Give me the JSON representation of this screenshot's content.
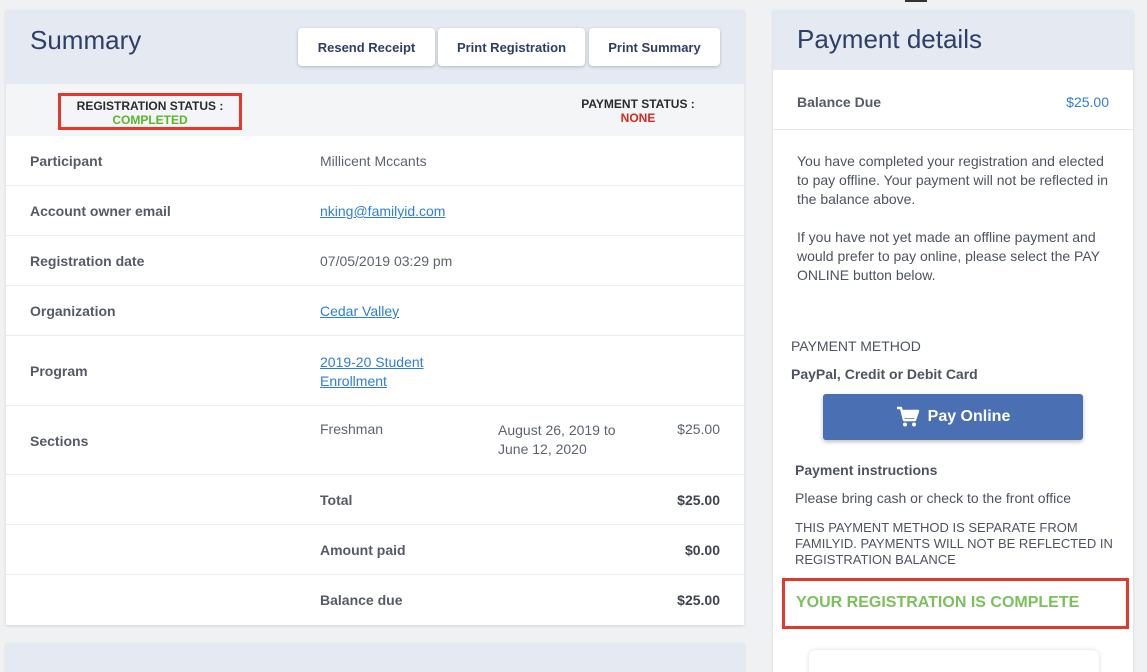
{
  "summary": {
    "title": "Summary",
    "buttons": {
      "resend_receipt": "Resend Receipt",
      "print_registration": "Print Registration",
      "print_summary": "Print Summary"
    },
    "registration_status_label": "REGISTRATION STATUS :",
    "registration_status_value": "COMPLETED",
    "payment_status_label": "PAYMENT STATUS :",
    "payment_status_value": "NONE",
    "rows": {
      "participant": {
        "label": "Participant",
        "value": "Millicent Mccants"
      },
      "email": {
        "label": "Account owner email",
        "value": "nking@familyid.com"
      },
      "reg_date": {
        "label": "Registration date",
        "value": "07/05/2019 03:29 pm"
      },
      "organization": {
        "label": "Organization",
        "value": "Cedar Valley"
      },
      "program": {
        "label": "Program",
        "value_line1": "2019-20 Student",
        "value_line2": "Enrollment"
      },
      "sections": {
        "label": "Sections",
        "name": "Freshman",
        "dates_line1": "August 26, 2019 to",
        "dates_line2": "June 12, 2020",
        "amount": "$25.00"
      }
    },
    "totals": {
      "total": {
        "label": "Total",
        "value": "$25.00"
      },
      "amount_paid": {
        "label": "Amount paid",
        "value": "$0.00"
      },
      "balance_due": {
        "label": "Balance due",
        "value": "$25.00"
      }
    }
  },
  "payment": {
    "title": "Payment details",
    "balance_label": "Balance Due",
    "balance_value": "$25.00",
    "info_1": "You have completed your registration and elected to pay offline. Your payment will not be reflected in the balance above.",
    "info_2": "If you have not yet made an offline payment and would prefer to pay online, please select the PAY ONLINE button below.",
    "method_label": "PAYMENT METHOD",
    "method_type": "PayPal, Credit or Debit Card",
    "pay_online": "Pay Online",
    "instructions_label": "Payment instructions",
    "instructions_text": "Please bring cash or check to the front office",
    "instructions_note": "THIS PAYMENT METHOD IS SEPARATE FROM FAMILYID. PAYMENTS WILL NOT BE REFLECTED IN REGISTRATION BALANCE",
    "complete_message": "YOUR REGISTRATION IS COMPLETE"
  },
  "icons": {
    "cart": "shopping-cart-icon"
  },
  "colors": {
    "accent_blue": "#4a6fb3",
    "link_blue": "#2f7dd6",
    "status_green": "#5ab52c",
    "status_red": "#d62b1f",
    "highlight_red": "#e5372a"
  }
}
